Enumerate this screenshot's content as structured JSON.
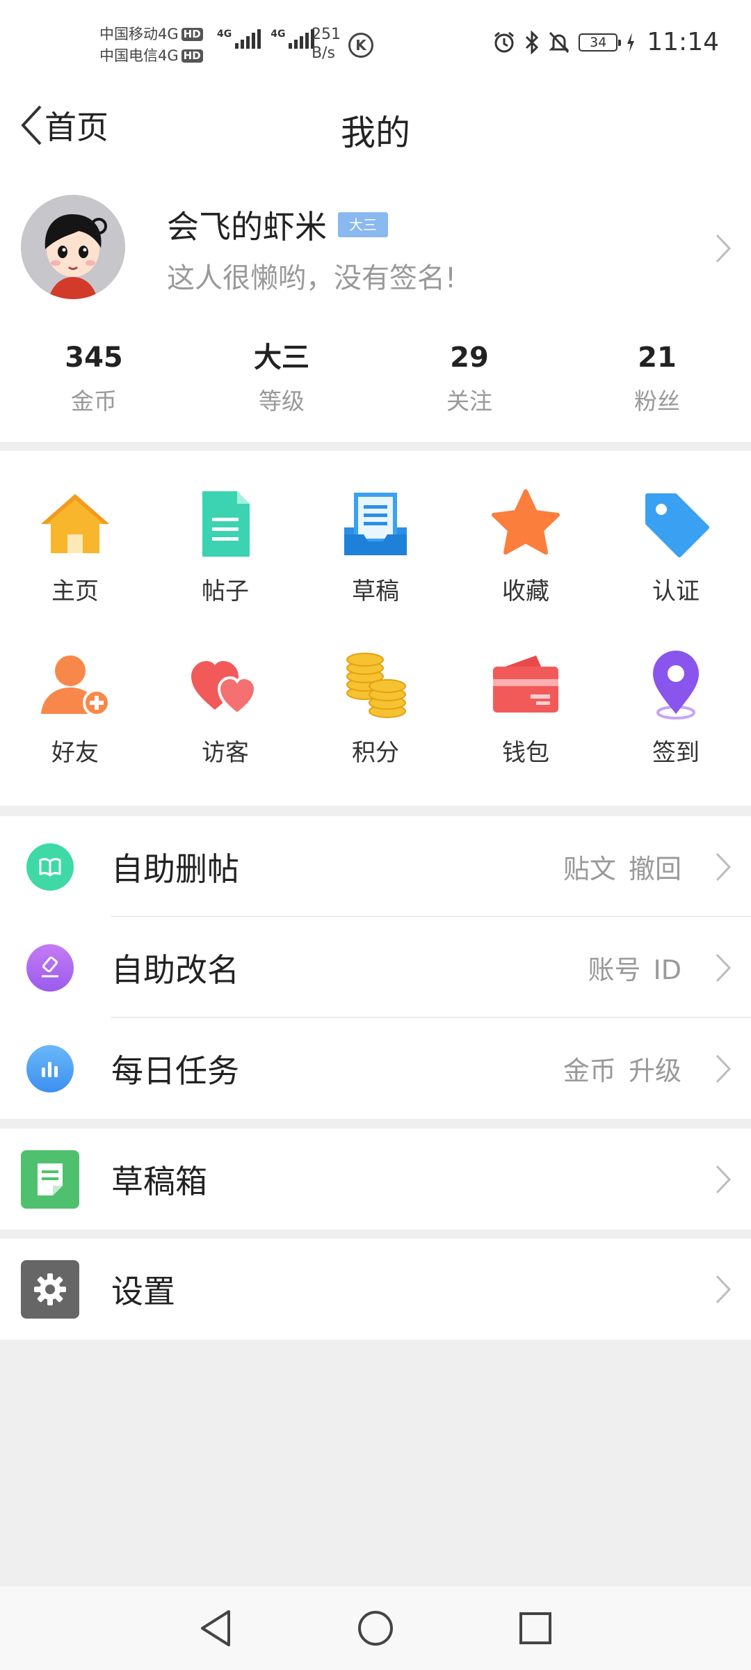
{
  "status_bar": {
    "carrier1": "中国移动4G",
    "carrier2": "中国电信4G",
    "hd": "HD",
    "net1": "4G",
    "net2": "4G",
    "speed_value": "251",
    "speed_unit": "B/s",
    "k_badge": "K",
    "battery": "34",
    "time": "11:14"
  },
  "header": {
    "back_label": "首页",
    "title": "我的"
  },
  "profile": {
    "username": "会飞的虾米",
    "level_badge": "大三",
    "signature": "这人很懒哟，没有签名!"
  },
  "stats": [
    {
      "value": "345",
      "label": "金币"
    },
    {
      "value": "大三",
      "label": "等级"
    },
    {
      "value": "29",
      "label": "关注"
    },
    {
      "value": "21",
      "label": "粉丝"
    }
  ],
  "grid": {
    "row1": [
      {
        "label": "主页",
        "icon": "home-icon"
      },
      {
        "label": "帖子",
        "icon": "document-icon"
      },
      {
        "label": "草稿",
        "icon": "draft-tray-icon"
      },
      {
        "label": "收藏",
        "icon": "star-icon"
      },
      {
        "label": "认证",
        "icon": "tag-icon"
      }
    ],
    "row2": [
      {
        "label": "好友",
        "icon": "add-friend-icon"
      },
      {
        "label": "访客",
        "icon": "hearts-icon"
      },
      {
        "label": "积分",
        "icon": "coins-icon"
      },
      {
        "label": "钱包",
        "icon": "wallet-icon"
      },
      {
        "label": "签到",
        "icon": "location-pin-icon"
      }
    ]
  },
  "list1": [
    {
      "label": "自助删帖",
      "extra": "贴文 撤回",
      "icon": "book-icon",
      "color": "#3fd9a6"
    },
    {
      "label": "自助改名",
      "extra": "账号 ID",
      "icon": "gavel-icon",
      "color": "#b56df0"
    },
    {
      "label": "每日任务",
      "extra": "金币 升级",
      "icon": "bar-chart-icon",
      "color": "#4aa3f5"
    }
  ],
  "list2": {
    "label": "草稿箱",
    "icon": "note-icon",
    "color": "#4fc16e"
  },
  "list3": {
    "label": "设置",
    "icon": "gear-icon",
    "color": "#666666"
  },
  "navigation": [
    "back-nav-icon",
    "home-nav-icon",
    "recents-nav-icon"
  ]
}
